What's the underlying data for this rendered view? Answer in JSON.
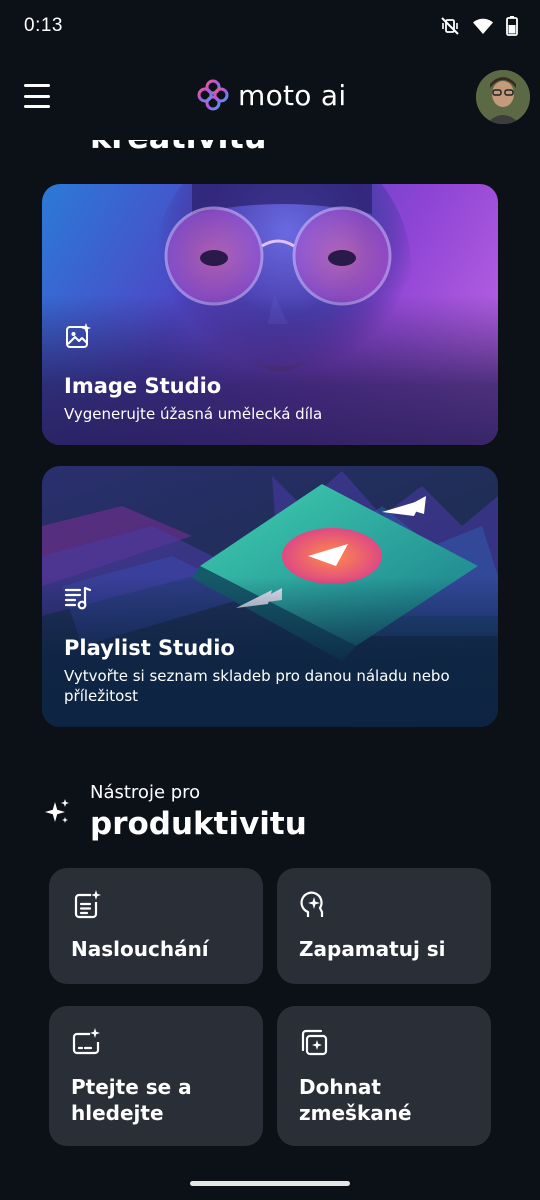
{
  "status_bar": {
    "time": "0:13"
  },
  "header": {
    "logo_text": "moto ai"
  },
  "scrolled_heading": "kreativitu",
  "cards": [
    {
      "title": "Image Studio",
      "description": "Vygenerujte úžasná umělecká díla",
      "icon": "image-sparkle-icon"
    },
    {
      "title": "Playlist Studio",
      "description": "Vytvořte si seznam skladeb pro danou náladu nebo příležitost",
      "icon": "playlist-music-icon"
    }
  ],
  "productivity": {
    "subtitle": "Nástroje pro",
    "title": "produktivitu",
    "tools": [
      {
        "label": "Naslouchání",
        "icon": "note-sparkle-icon"
      },
      {
        "label": "Zapamatuj si",
        "icon": "brain-sparkle-icon"
      },
      {
        "label": "Ptejte se a hledejte",
        "icon": "search-sparkle-icon"
      },
      {
        "label": "Dohnat zmeškané",
        "icon": "catch-up-icon"
      }
    ]
  },
  "colors": {
    "background": "#0c1017",
    "tile": "#2a2e37",
    "accent_pink": "#e8557a",
    "accent_purple": "#8e44d4"
  }
}
